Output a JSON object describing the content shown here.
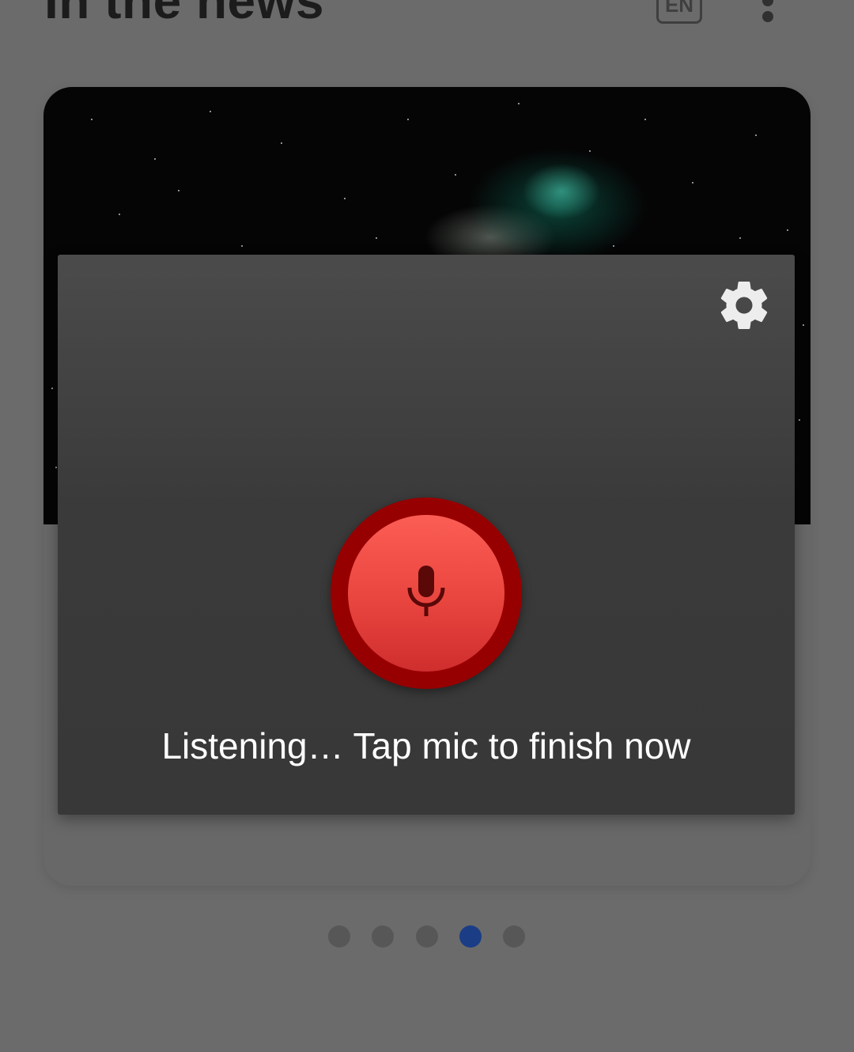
{
  "header": {
    "title": "In the news",
    "language_badge": "EN"
  },
  "voice_dialog": {
    "status_text": "Listening… Tap mic to finish now",
    "mic_color": "#e9453f",
    "mic_ring_color": "#970000"
  },
  "pager": {
    "total": 5,
    "active_index": 3,
    "active_color": "#1a3d86",
    "inactive_color": "#575757"
  },
  "icons": {
    "settings": "gear-icon",
    "microphone": "microphone-icon",
    "overflow": "more-vert-icon"
  }
}
